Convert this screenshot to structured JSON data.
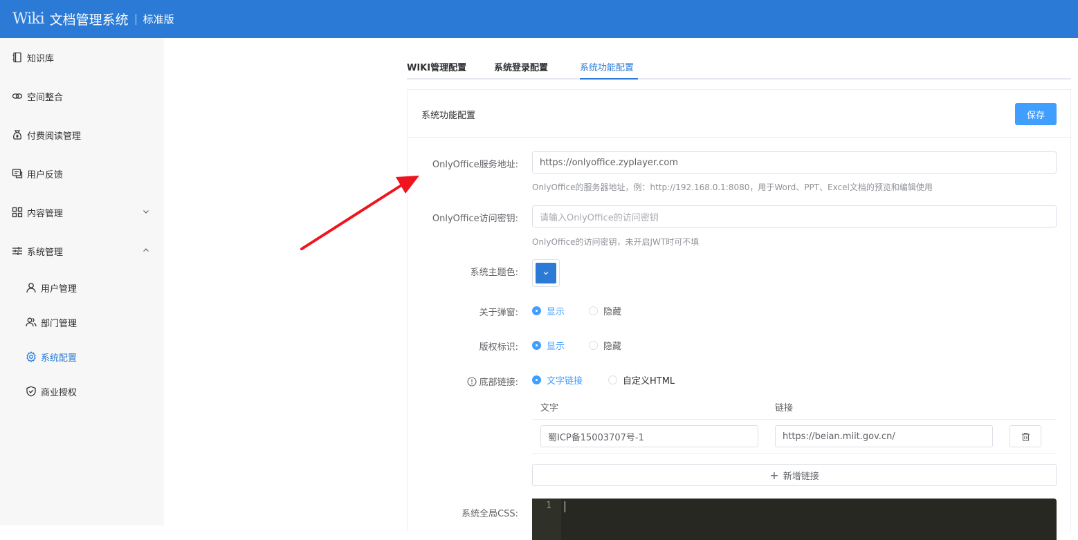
{
  "header": {
    "logo": "Wiki",
    "title": "文档管理系统",
    "edition": "标准版"
  },
  "sidebar": {
    "items": [
      {
        "label": "知识库",
        "icon": "book-icon"
      },
      {
        "label": "空间整合",
        "icon": "link-icon"
      },
      {
        "label": "付费阅读管理",
        "icon": "money-bag-icon"
      },
      {
        "label": "用户反馈",
        "icon": "feedback-icon"
      },
      {
        "label": "内容管理",
        "icon": "grid-icon"
      },
      {
        "label": "系统管理",
        "icon": "sliders-icon"
      }
    ],
    "sub_items": [
      {
        "label": "用户管理",
        "icon": "user-icon"
      },
      {
        "label": "部门管理",
        "icon": "users-icon"
      },
      {
        "label": "系统配置",
        "icon": "gear-icon",
        "active": true
      },
      {
        "label": "商业授权",
        "icon": "shield-check-icon"
      }
    ]
  },
  "tabs": [
    {
      "label": "WIKI管理配置"
    },
    {
      "label": "系统登录配置"
    },
    {
      "label": "系统功能配置",
      "active": true
    }
  ],
  "card": {
    "title": "系统功能配置",
    "save_label": "保存"
  },
  "form": {
    "onlyoffice_url": {
      "label": "OnlyOffice服务地址:",
      "value": "https://onlyoffice.zyplayer.com",
      "help": "OnlyOffice的服务器地址，例：http://192.168.0.1:8080，用于Word、PPT、Excel文档的预览和编辑使用"
    },
    "onlyoffice_secret": {
      "label": "OnlyOffice访问密钥:",
      "placeholder": "请输入OnlyOffice的访问密钥",
      "help": "OnlyOffice的访问密钥，未开启JWT时可不填"
    },
    "theme_color": {
      "label": "系统主题色:",
      "value": "#2b7bd6"
    },
    "about_popup": {
      "label": "关于弹窗:",
      "options": [
        "显示",
        "隐藏"
      ],
      "selected": "显示"
    },
    "copyright": {
      "label": "版权标识:",
      "options": [
        "显示",
        "隐藏"
      ],
      "selected": "显示"
    },
    "footer_links": {
      "label": "底部链接:",
      "options": [
        "文字链接",
        "自定义HTML"
      ],
      "selected": "文字链接",
      "columns": [
        "文字",
        "链接"
      ],
      "rows": [
        {
          "text": "蜀ICP备15003707号-1",
          "link": "https://beian.miit.gov.cn/"
        }
      ],
      "add_label": "新增链接"
    },
    "global_css": {
      "label": "系统全局CSS:",
      "line_number": "1"
    }
  },
  "colors": {
    "primary": "#2b7bd6",
    "accent": "#409eff",
    "annotation_arrow": "#f0141e"
  }
}
